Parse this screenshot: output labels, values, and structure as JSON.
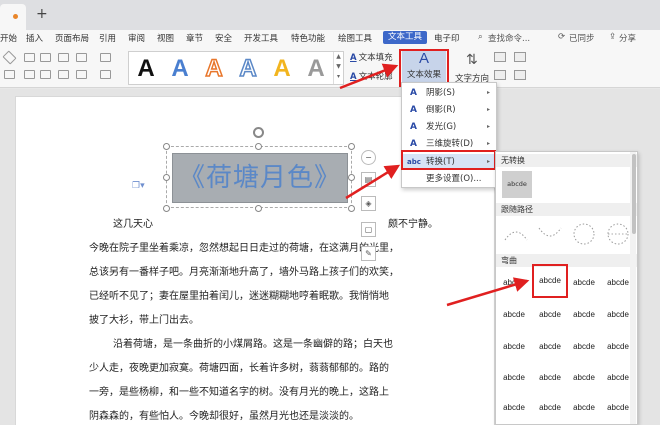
{
  "tabs": {
    "new_tab": "+"
  },
  "menu": {
    "items": [
      "开始",
      "插入",
      "页面布局",
      "引用",
      "审阅",
      "视图",
      "章节",
      "安全",
      "开发工具",
      "特色功能",
      "绘图工具",
      "文本工具",
      "电子印"
    ],
    "active": "文本工具",
    "search": "查找命令...",
    "sync": "已同步",
    "share": "分享"
  },
  "ribbon": {
    "text_fill": "文本填充",
    "text_outline": "文本轮廓",
    "text_effect": "文本效果",
    "text_direction": "文字方向",
    "style_letter": "A"
  },
  "document": {
    "wordart": "《荷塘月色》",
    "lines": [
      "这几天心",
      "今晚在院子里坐着乘凉，忽然想起日日走过的荷塘，在这满月的光里，",
      "总该另有一番样子吧。月亮渐渐地升高了，墙外马路上孩子们的欢笑，",
      "已经听不见了；妻在屋里拍着闰儿，迷迷糊糊地哼着眠歌。我悄悄地",
      "披了大衫，带上门出去。",
      "沿着荷塘，是一条曲折的小煤屑路。这是一条幽僻的路；白天也",
      "少人走，夜晚更加寂寞。荷塘四面，长着许多树，蓊蓊郁郁的。路的",
      "一旁，是些杨柳，和一些不知道名字的树。没有月光的晚上，这路上",
      "阴森森的，有些怕人。今晚却很好，虽然月光也还是淡淡的。"
    ],
    "line1_tail": "颇不宁静。"
  },
  "effect_menu": {
    "items": [
      {
        "icon": "A",
        "label": "阴影(S)",
        "arrow": "▸"
      },
      {
        "icon": "A",
        "label": "倒影(R)",
        "arrow": "▸"
      },
      {
        "icon": "A",
        "label": "发光(G)",
        "arrow": "▸"
      },
      {
        "icon": "A",
        "label": "三维旋转(D)",
        "arrow": "▸"
      },
      {
        "icon": "abc",
        "label": "转换(T)",
        "arrow": "▸"
      },
      {
        "icon": "",
        "label": "更多设置(O)...",
        "arrow": ""
      }
    ]
  },
  "transform": {
    "no_transform_header": "无转换",
    "no_transform_sample": "abcde",
    "follow_path_header": "跟随路径",
    "warp_header": "弯曲",
    "warp_samples": [
      "abcde",
      "abcde",
      "abcde",
      "abcde",
      "abcde",
      "abcde",
      "abcde",
      "abcde",
      "abcde",
      "abcde",
      "abcde",
      "abcde",
      "abcde",
      "abcde",
      "abcde",
      "abcde",
      "abcde",
      "abcde",
      "abcde",
      "abcde"
    ]
  },
  "colors": {
    "accent": "#3d68c9",
    "highlight": "#e02020",
    "wordart": "#5b88c7"
  }
}
